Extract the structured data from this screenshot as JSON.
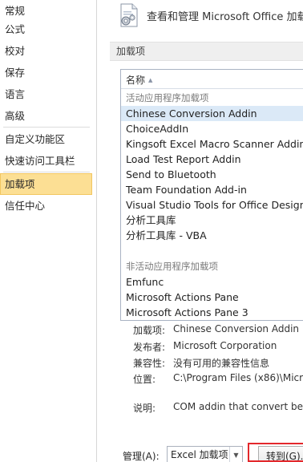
{
  "sidebar": {
    "items": [
      {
        "label": "常规"
      },
      {
        "label": "公式"
      },
      {
        "label": "校对"
      },
      {
        "label": "保存"
      },
      {
        "label": "语言"
      },
      {
        "label": "高级"
      },
      {
        "label": "自定义功能区"
      },
      {
        "label": "快速访问工具栏"
      },
      {
        "label": "加载项",
        "active": true
      },
      {
        "label": "信任中心"
      }
    ]
  },
  "header": {
    "icon": "addin-gear-page-icon",
    "title": "查看和管理 Microsoft Office 加载"
  },
  "section": {
    "title": "加载项"
  },
  "addin_list": {
    "column_header": "名称",
    "sort_indicator": "▲",
    "active_group": {
      "label": "活动应用程序加载项",
      "items": [
        "Chinese Conversion Addin",
        "ChoiceAddIn",
        "Kingsoft Excel Macro Scanner Addin",
        "Load Test Report Addin",
        "Send to Bluetooth",
        "Team Foundation Add-in",
        "Visual Studio Tools for Office Design-T",
        "分析工具库",
        "分析工具库 - VBA"
      ]
    },
    "inactive_group": {
      "label": "非活动应用程序加载项",
      "items": [
        "Emfunc",
        "Microsoft Actions Pane",
        "Microsoft Actions Pane 3"
      ]
    },
    "selected_item": "Chinese Conversion Addin"
  },
  "details": {
    "addin_label": "加载项:",
    "addin_value": "Chinese Conversion Addin",
    "publisher_label": "发布者:",
    "publisher_value": "Microsoft Corporation",
    "compat_label": "兼容性:",
    "compat_value": "没有可用的兼容性信息",
    "location_label": "位置:",
    "location_value": "C:\\Program Files (x86)\\Micro",
    "description_label": "说明:",
    "description_value": "COM addin that convert bet"
  },
  "manage": {
    "label": "管理(A):",
    "selected": "Excel 加载项",
    "go_button": "转到(G)..."
  },
  "colors": {
    "active_nav_bg": "#fcdf94",
    "selected_row_bg": "#dbe9f7",
    "highlight_border": "#e3282c"
  }
}
